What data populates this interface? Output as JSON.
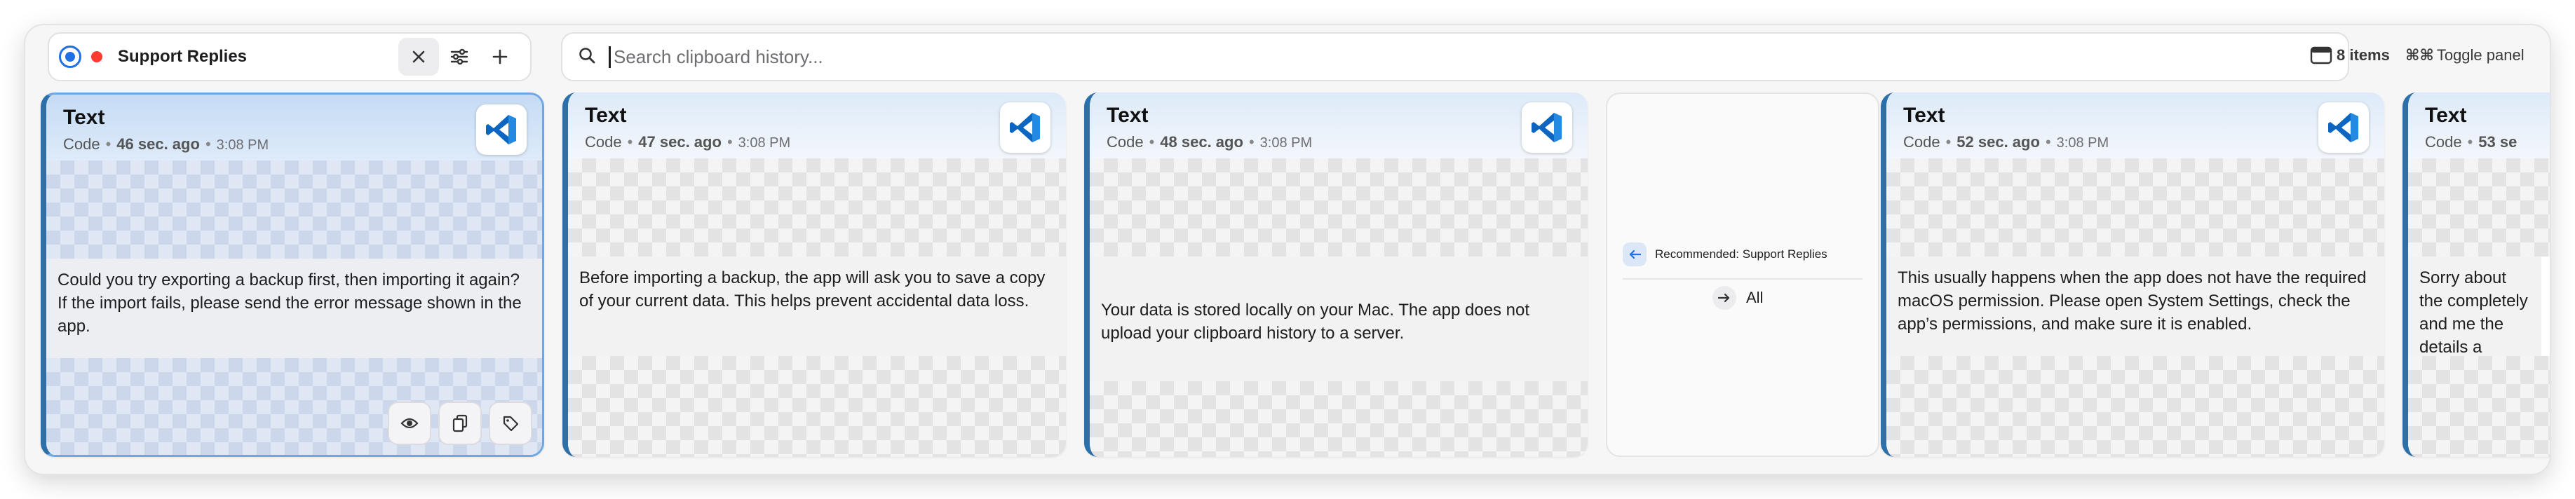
{
  "collection": {
    "name": "Support Replies",
    "close_icon": "close-icon",
    "settings_icon": "sliders-icon",
    "add_icon": "plus-icon"
  },
  "search": {
    "placeholder": "Search clipboard history...",
    "value": ""
  },
  "items_count": "8 items",
  "toggle_panel": {
    "shortcut": "⌘⌘",
    "label": "Toggle panel"
  },
  "colors": {
    "accent": "#1f6fe5",
    "card_stripe": "#2d6fa8",
    "selected_border": "#6fa7e3",
    "red_dot": "#ff3b30"
  },
  "cards": [
    {
      "type": "Text",
      "app": "Code",
      "age": "46 sec. ago",
      "time": "3:08 PM",
      "text": "Could you try exporting a backup first, then importing it again? If the import fails, please send the error message shown in the app.",
      "app_icon": "vscode-icon",
      "selected": true
    },
    {
      "type": "Text",
      "app": "Code",
      "age": "47 sec. ago",
      "time": "3:08 PM",
      "text": "Before importing a backup, the app will ask you to save a copy of your current data. This helps prevent accidental data loss.",
      "app_icon": "vscode-icon"
    },
    {
      "type": "Text",
      "app": "Code",
      "age": "48 sec. ago",
      "time": "3:08 PM",
      "text": "Your data is stored locally on your Mac. The app does not upload your clipboard history to a server.",
      "app_icon": "vscode-icon"
    },
    {
      "type": "Text",
      "app": "Code",
      "age": "52 sec. ago",
      "time": "3:08 PM",
      "text": "This usually happens when the app does not have the required macOS permission. Please open System Settings, check the app’s permissions, and make sure it is enabled.",
      "app_icon": "vscode-icon"
    },
    {
      "type": "Text",
      "app": "Code",
      "age": "53 se",
      "time": "",
      "text": "Sorry about the completely and me the details a",
      "app_icon": "vscode-icon"
    }
  ],
  "card_actions": [
    "eye-icon",
    "copy-icon",
    "tag-icon"
  ],
  "recommended": {
    "label": "Recommended: Support Replies",
    "all_label": "All"
  },
  "meta_separator": "•"
}
